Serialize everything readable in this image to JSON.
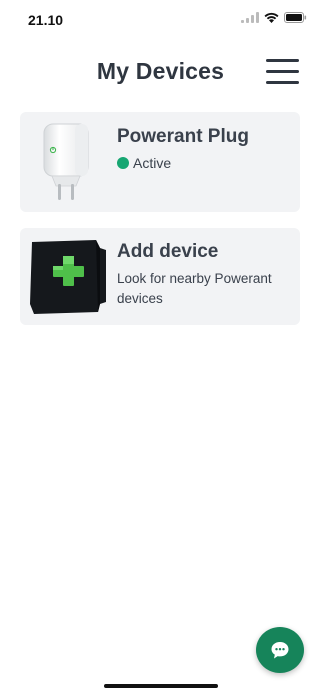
{
  "status_bar": {
    "time": "21.10",
    "icons": [
      "cellular-signal-icon",
      "wifi-icon",
      "battery-icon"
    ]
  },
  "header": {
    "title": "My Devices",
    "menu_icon": "hamburger-menu-icon"
  },
  "devices": [
    {
      "name": "Powerant Plug",
      "status": "Active",
      "status_color": "#17a672",
      "image": "smart-plug-image"
    }
  ],
  "add_device": {
    "title": "Add device",
    "subtitle": "Look for nearby Powerant devices",
    "image": "add-device-image"
  },
  "chat_button": {
    "icon": "chat-bubble-icon",
    "color": "#16845a"
  }
}
